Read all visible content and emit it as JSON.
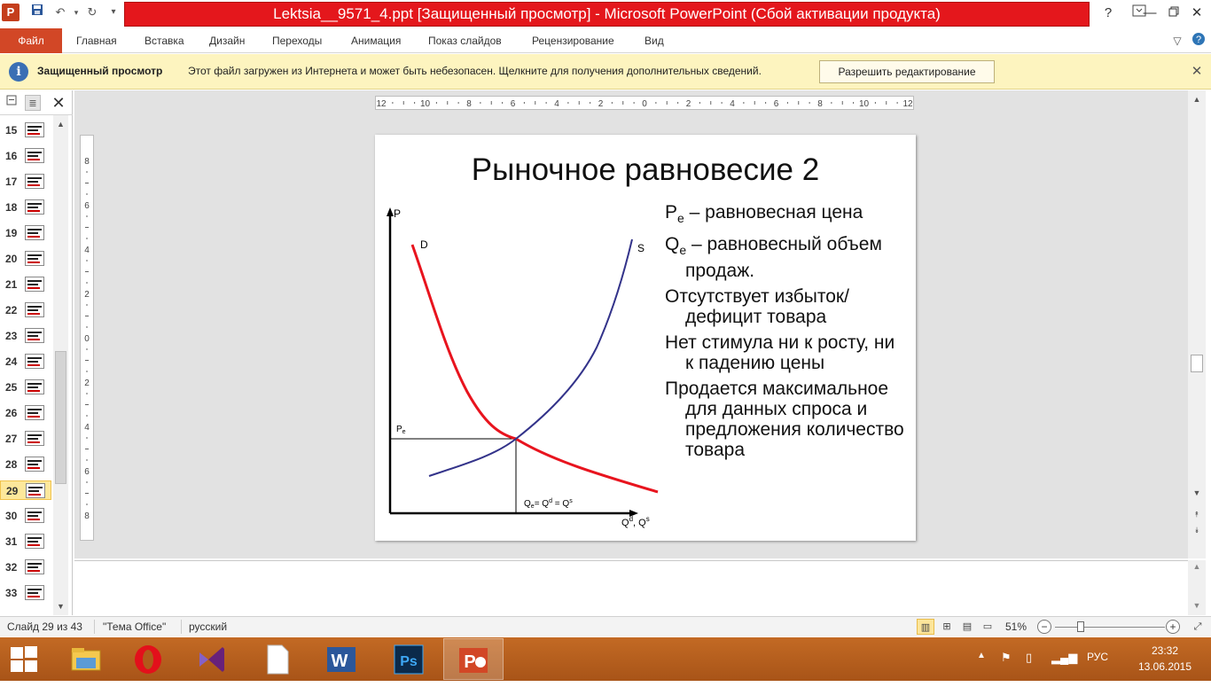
{
  "window": {
    "title": "Lektsia__9571_4.ppt [Защищенный просмотр] - Microsoft PowerPoint (Сбой активации продукта)",
    "app_icon": "P"
  },
  "ribbon": {
    "file_tab": "Файл",
    "tabs": [
      "Главная",
      "Вставка",
      "Дизайн",
      "Переходы",
      "Анимация",
      "Показ слайдов",
      "Рецензирование",
      "Вид"
    ]
  },
  "protected_view": {
    "title": "Защищенный просмотр",
    "message": "Этот файл загружен из Интернета и может быть небезопасен. Щелкните для получения дополнительных сведений.",
    "button": "Разрешить редактирование"
  },
  "thumbnails": {
    "numbers": [
      "15",
      "16",
      "17",
      "18",
      "19",
      "20",
      "21",
      "22",
      "23",
      "24",
      "25",
      "26",
      "27",
      "28",
      "29",
      "30",
      "31",
      "32",
      "33"
    ],
    "selected": "29"
  },
  "ruler": {
    "horizontal_labels": [
      "12",
      "10",
      "8",
      "6",
      "4",
      "2",
      "0",
      "2",
      "4",
      "6",
      "8",
      "10",
      "12"
    ],
    "vertical_labels": [
      "8",
      "6",
      "4",
      "2",
      "0",
      "2",
      "4",
      "6",
      "8"
    ]
  },
  "slide": {
    "title": "Рыночное равновесие 2",
    "bullets": [
      {
        "main": "P",
        "sub": "e",
        "rest": " – равновесная цена"
      },
      {
        "main": "Q",
        "sub": "e",
        "rest": " – равновесный объем продаж."
      },
      {
        "main": "",
        "sub": "",
        "rest": "Отсутствует избыток/дефицит товара"
      },
      {
        "main": "",
        "sub": "",
        "rest": "Нет стимула ни к росту, ни к падению цены"
      },
      {
        "main": "",
        "sub": "",
        "rest": "Продается максимальное для данных спроса и предложения количество товара"
      }
    ],
    "graph": {
      "y_axis_label": "P",
      "x_axis_label": "Q",
      "x_axis_label_sup1": "d",
      "x_axis_label_sep": ", Q",
      "x_axis_label_sup2": "s",
      "demand_label": "D",
      "supply_label": "S",
      "pe_label": "P",
      "pe_sub": "e",
      "qe_label": "Q",
      "qe_sub": "e",
      "qe_eq1": "= Q",
      "qe_sup1": "d",
      "qe_eq2": " = Q",
      "qe_sup2": "s",
      "demand_color": "#e8141e",
      "supply_color": "#33338a"
    }
  },
  "status": {
    "slide_info": "Слайд 29 из 43",
    "theme": "\"Тема Office\"",
    "language": "русский",
    "zoom": "51%"
  },
  "taskbar": {
    "apps": [
      "file-explorer",
      "opera",
      "visual-studio",
      "notepad",
      "word",
      "photoshop",
      "powerpoint"
    ],
    "active_app": "powerpoint",
    "tray_lang": "РУС",
    "time": "23:32",
    "date": "13.06.2015"
  }
}
